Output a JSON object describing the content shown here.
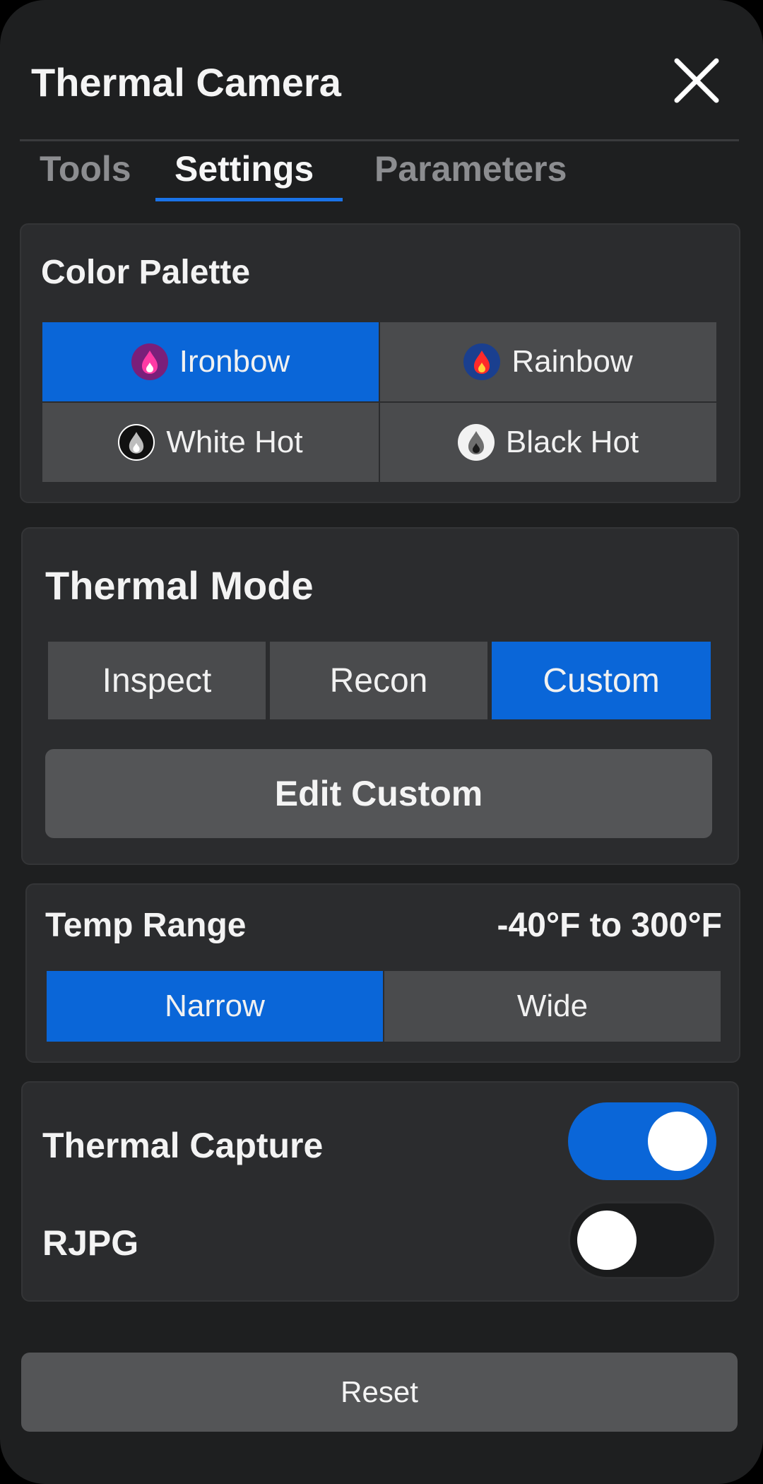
{
  "header": {
    "title": "Thermal Camera",
    "close_icon": "close-icon"
  },
  "tabs": [
    {
      "label": "Tools",
      "active": false
    },
    {
      "label": "Settings",
      "active": true
    },
    {
      "label": "Parameters",
      "active": false
    }
  ],
  "color_palette": {
    "title": "Color Palette",
    "options": [
      {
        "label": "Ironbow",
        "icon": "flame-ironbow-icon",
        "selected": true
      },
      {
        "label": "Rainbow",
        "icon": "flame-rainbow-icon",
        "selected": false
      },
      {
        "label": "White Hot",
        "icon": "flame-white-hot-icon",
        "selected": false
      },
      {
        "label": "Black Hot",
        "icon": "flame-black-hot-icon",
        "selected": false
      }
    ]
  },
  "thermal_mode": {
    "title": "Thermal Mode",
    "options": [
      {
        "label": "Inspect",
        "selected": false
      },
      {
        "label": "Recon",
        "selected": false
      },
      {
        "label": "Custom",
        "selected": true
      }
    ],
    "edit_label": "Edit Custom"
  },
  "temp_range": {
    "title": "Temp Range",
    "value": "-40°F to 300°F",
    "options": [
      {
        "label": "Narrow",
        "selected": true
      },
      {
        "label": "Wide",
        "selected": false
      }
    ]
  },
  "toggles": [
    {
      "label": "Thermal Capture",
      "on": true
    },
    {
      "label": "RJPG",
      "on": false
    }
  ],
  "reset_label": "Reset",
  "colors": {
    "accent": "#0a66d8",
    "background": "#1e1f20",
    "card": "#2b2c2e",
    "segment": "#4a4b4d"
  }
}
